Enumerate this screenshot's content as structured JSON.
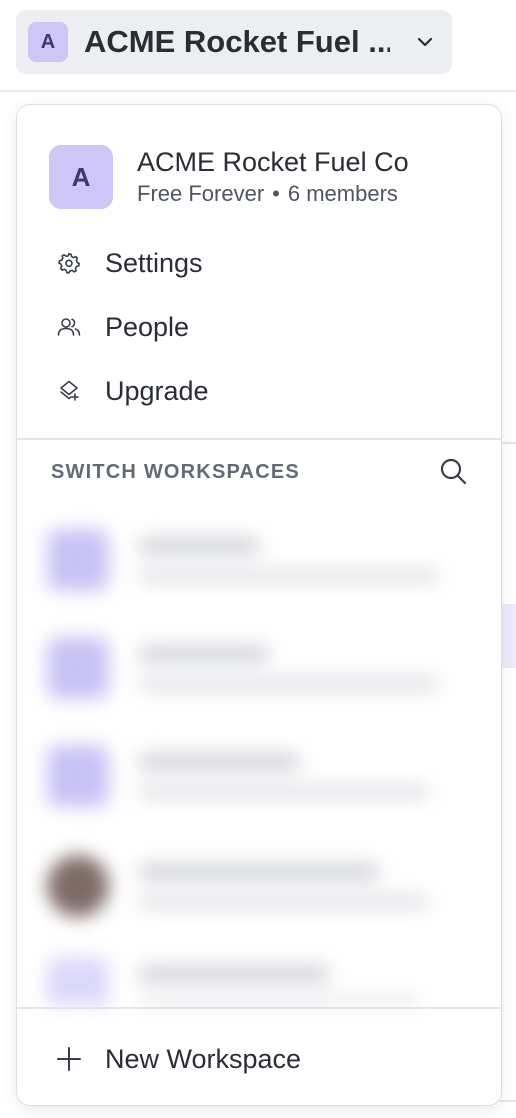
{
  "switcher": {
    "avatar_letter": "A",
    "name": "ACME Rocket Fuel ...",
    "chevron_icon": "chevron-down-icon"
  },
  "dropdown": {
    "avatar_letter": "A",
    "avatar_color": "#cdc6f7",
    "workspace_name": "ACME Rocket Fuel Co",
    "plan": "Free Forever",
    "separator": "•",
    "members": "6 members",
    "menu": [
      {
        "label": "Settings",
        "icon": "gear-icon"
      },
      {
        "label": "People",
        "icon": "people-icon"
      },
      {
        "label": "Upgrade",
        "icon": "upgrade-icon"
      }
    ],
    "switch_title": "SWITCH WORKSPACES",
    "search_icon": "search-icon",
    "workspaces_blurred": [
      {
        "avatar_color": "#c9c3f5"
      },
      {
        "avatar_color": "#c9c3f5"
      },
      {
        "avatar_color": "#c9c3f5"
      },
      {
        "avatar_color": "#7e6b66"
      },
      {
        "avatar_color": "#dcd8fa"
      }
    ],
    "new_workspace": {
      "label": "New Workspace",
      "icon": "plus-icon"
    }
  }
}
